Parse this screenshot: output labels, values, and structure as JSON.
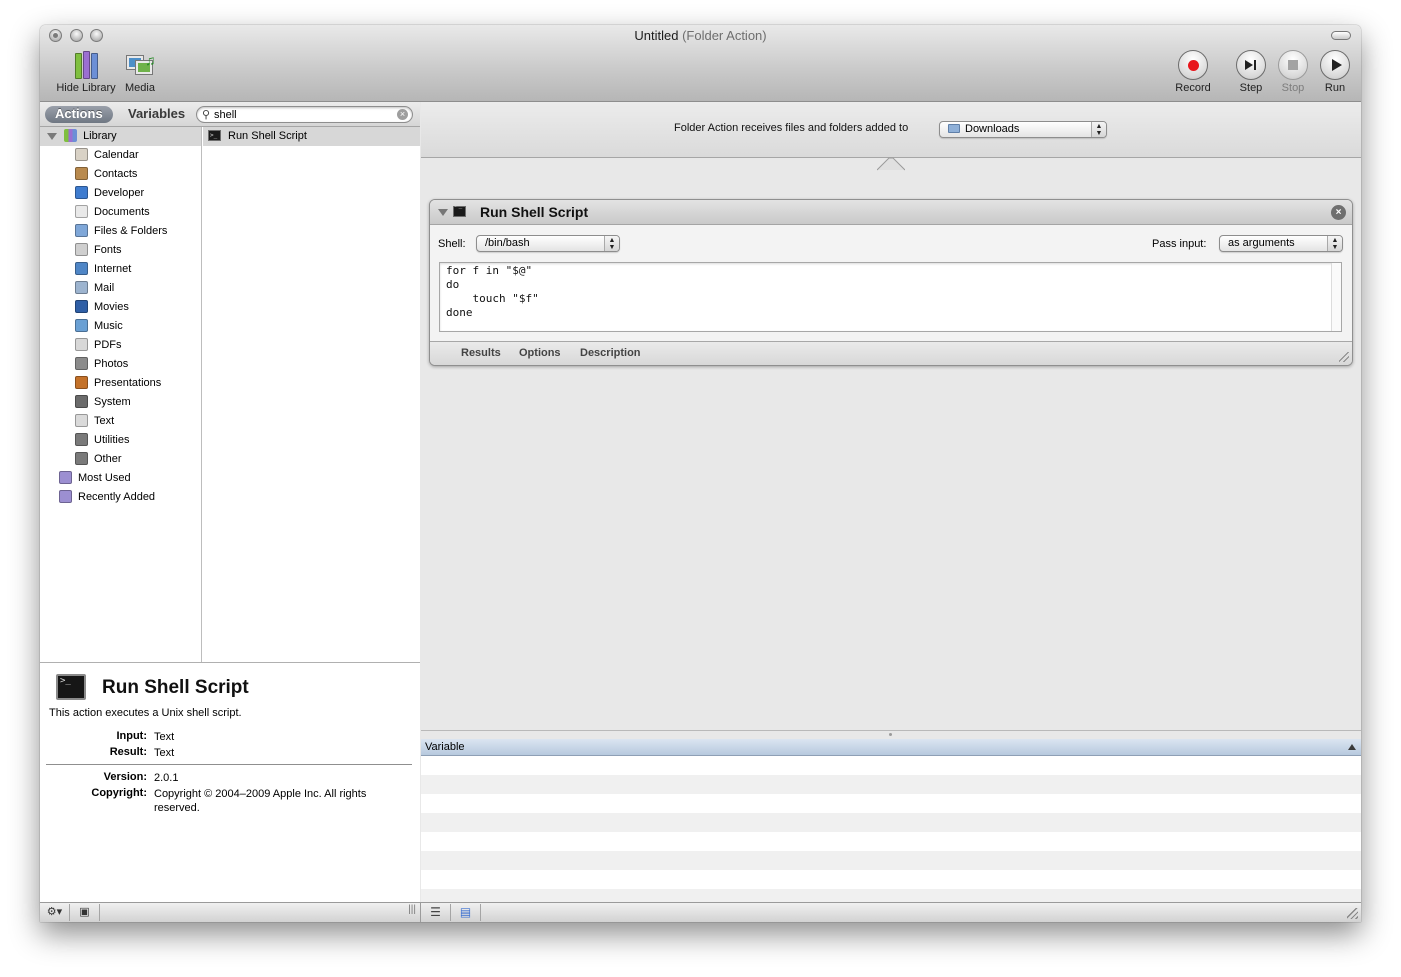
{
  "window": {
    "title": "Untitled",
    "subtitle": "(Folder Action)"
  },
  "toolbar": {
    "hide_library": "Hide Library",
    "media": "Media",
    "record": "Record",
    "step": "Step",
    "stop": "Stop",
    "run": "Run"
  },
  "library": {
    "tab_actions": "Actions",
    "tab_variables": "Variables",
    "search_value": "shell",
    "root": "Library",
    "items": [
      {
        "label": "Calendar",
        "icon": "calendar-icon",
        "color": "#d9d2c6"
      },
      {
        "label": "Contacts",
        "icon": "contacts-icon",
        "color": "#b98a4e"
      },
      {
        "label": "Developer",
        "icon": "developer-icon",
        "color": "#3f7ccf"
      },
      {
        "label": "Documents",
        "icon": "documents-icon",
        "color": "#e9e9e9"
      },
      {
        "label": "Files & Folders",
        "icon": "folder-icon",
        "color": "#7fa7d8"
      },
      {
        "label": "Fonts",
        "icon": "fonts-icon",
        "color": "#cfcfcf"
      },
      {
        "label": "Internet",
        "icon": "internet-icon",
        "color": "#4f86c6"
      },
      {
        "label": "Mail",
        "icon": "mail-icon",
        "color": "#9db4cf"
      },
      {
        "label": "Movies",
        "icon": "movies-icon",
        "color": "#2f5fa6"
      },
      {
        "label": "Music",
        "icon": "music-icon",
        "color": "#6aa0d4"
      },
      {
        "label": "PDFs",
        "icon": "pdf-icon",
        "color": "#d8d8d8"
      },
      {
        "label": "Photos",
        "icon": "photos-icon",
        "color": "#8b8b8b"
      },
      {
        "label": "Presentations",
        "icon": "presentations-icon",
        "color": "#c4722a"
      },
      {
        "label": "System",
        "icon": "system-icon",
        "color": "#6b6b6b"
      },
      {
        "label": "Text",
        "icon": "text-icon",
        "color": "#dadada"
      },
      {
        "label": "Utilities",
        "icon": "utilities-icon",
        "color": "#7a7a7a"
      },
      {
        "label": "Other",
        "icon": "other-icon",
        "color": "#7a7a7a"
      }
    ],
    "smart": [
      {
        "label": "Most Used",
        "icon": "smart-folder-icon",
        "color": "#9c8fd1"
      },
      {
        "label": "Recently Added",
        "icon": "smart-folder-icon",
        "color": "#9c8fd1"
      }
    ],
    "results": [
      "Run Shell Script"
    ]
  },
  "description": {
    "title": "Run Shell Script",
    "text": "This action executes a Unix shell script.",
    "input_label": "Input:",
    "input_value": "Text",
    "result_label": "Result:",
    "result_value": "Text",
    "version_label": "Version:",
    "version_value": "2.0.1",
    "copyright_label": "Copyright:",
    "copyright_value": "Copyright © 2004–2009 Apple Inc.  All rights reserved."
  },
  "folder_action": {
    "label": "Folder Action receives files and folders added to",
    "folder": "Downloads"
  },
  "action": {
    "title": "Run Shell Script",
    "shell_label": "Shell:",
    "shell_value": "/bin/bash",
    "pass_label": "Pass input:",
    "pass_value": "as arguments",
    "script": "for f in \"$@\"\ndo\n    touch \"$f\"\ndone",
    "tabs": [
      "Results",
      "Options",
      "Description"
    ]
  },
  "variables": {
    "column": "Variable"
  },
  "colors": {
    "record": "#e8161b",
    "selection": "#d7d7d7",
    "header_blue": "#b7c9de"
  }
}
